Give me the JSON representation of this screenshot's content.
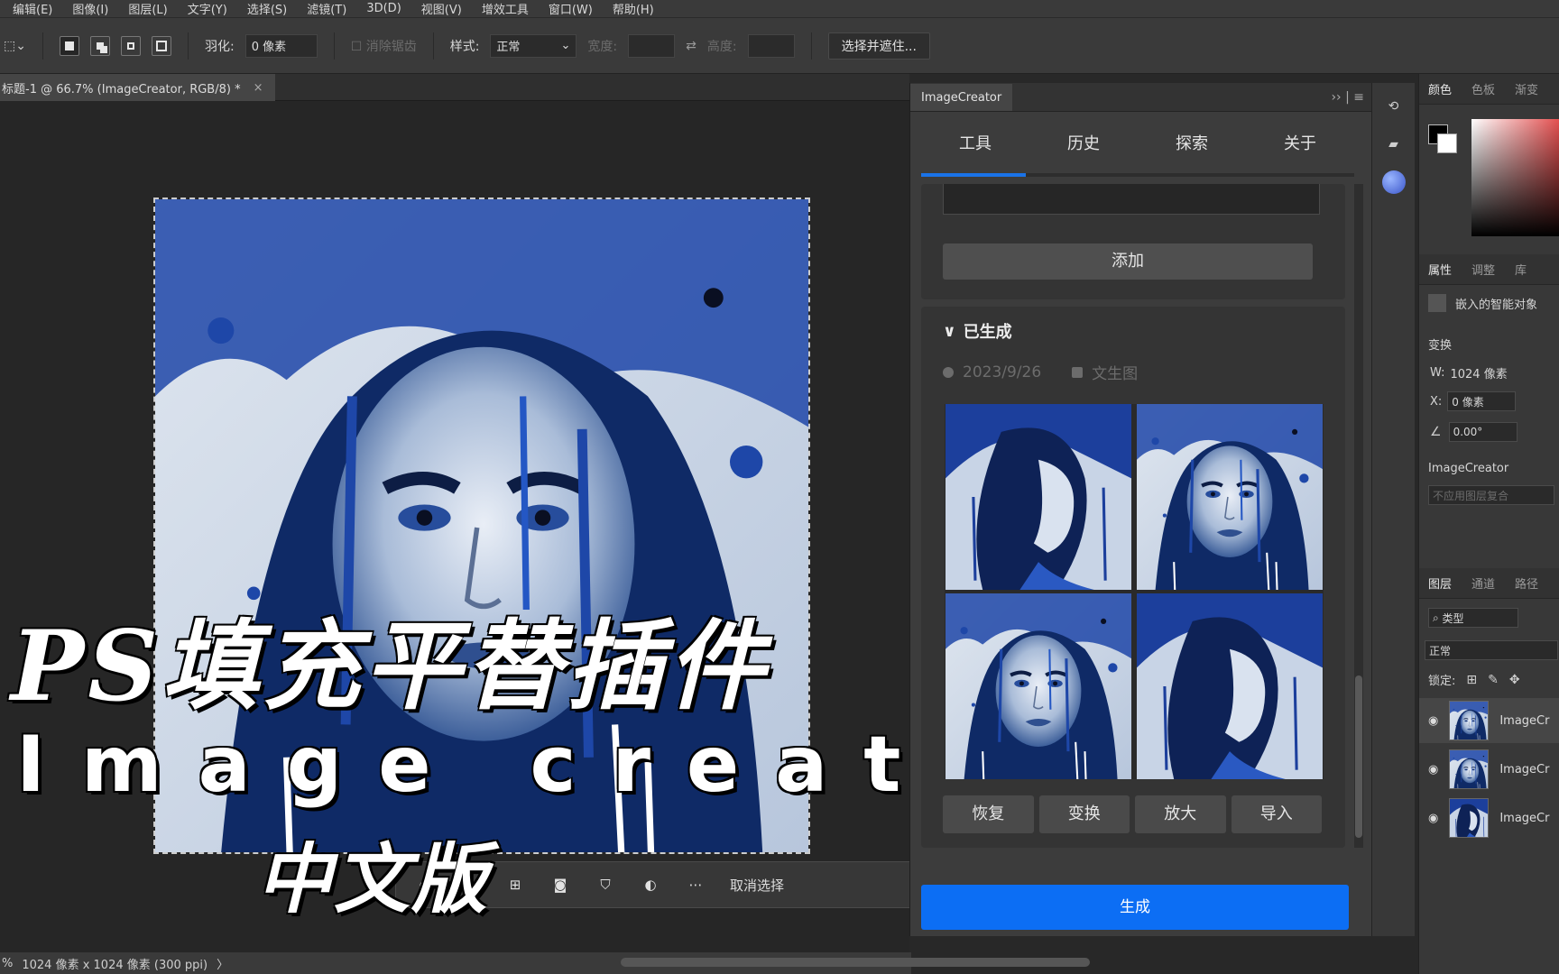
{
  "menu": [
    "编辑(E)",
    "图像(I)",
    "图层(L)",
    "文字(Y)",
    "选择(S)",
    "滤镜(T)",
    "3D(D)",
    "视图(V)",
    "增效工具",
    "窗口(W)",
    "帮助(H)"
  ],
  "options": {
    "feather_label": "羽化:",
    "feather_value": "0 像素",
    "antialias_label": "消除锯齿",
    "style_label": "样式:",
    "style_value": "正常",
    "width_label": "宽度:",
    "height_label": "高度:",
    "select_mask_button": "选择并遮住..."
  },
  "document": {
    "tab_title": "标题-1 @ 66.7% (ImageCreator, RGB/8) *"
  },
  "context_bar": {
    "cancel_selection": "取消选择"
  },
  "overlay": {
    "line1": "PS填充平替插件",
    "line2": "Image create",
    "line3": "中文版"
  },
  "status": {
    "zoom": "%",
    "dims": "1024 像素 x 1024 像素 (300 ppi)"
  },
  "plugin": {
    "title": "ImageCreator",
    "tabs": [
      "工具",
      "历史",
      "探索",
      "关于"
    ],
    "add_button": "添加",
    "generated_title": "已生成",
    "date": "2023/9/26",
    "mode": "文生图",
    "actions": [
      "恢复",
      "变换",
      "放大",
      "导入"
    ],
    "generate_button": "生成"
  },
  "right_panel": {
    "color_tabs": [
      "颜色",
      "色板",
      "渐变"
    ],
    "prop_tabs": [
      "属性",
      "调整",
      "库"
    ],
    "smart_object": "嵌入的智能对象",
    "transform_label": "变换",
    "w_label": "W:",
    "w_value": "1024 像素",
    "x_label": "X:",
    "x_value": "0 像素",
    "angle_value": "0.00°",
    "layer_comp_label": "ImageCreator",
    "layer_comp_value": "不应用图层复合",
    "layer_tabs": [
      "图层",
      "通道",
      "路径"
    ],
    "kind_filter": "类型",
    "blend_mode": "正常",
    "lock_label": "锁定:",
    "layers": [
      "ImageCr",
      "ImageCr",
      "ImageCr"
    ]
  },
  "colors": {
    "accent": "#0c6ef4",
    "tab_underline": "#1a73e8",
    "panel": "#3c3c3c",
    "canvas_bg": "#262626"
  }
}
